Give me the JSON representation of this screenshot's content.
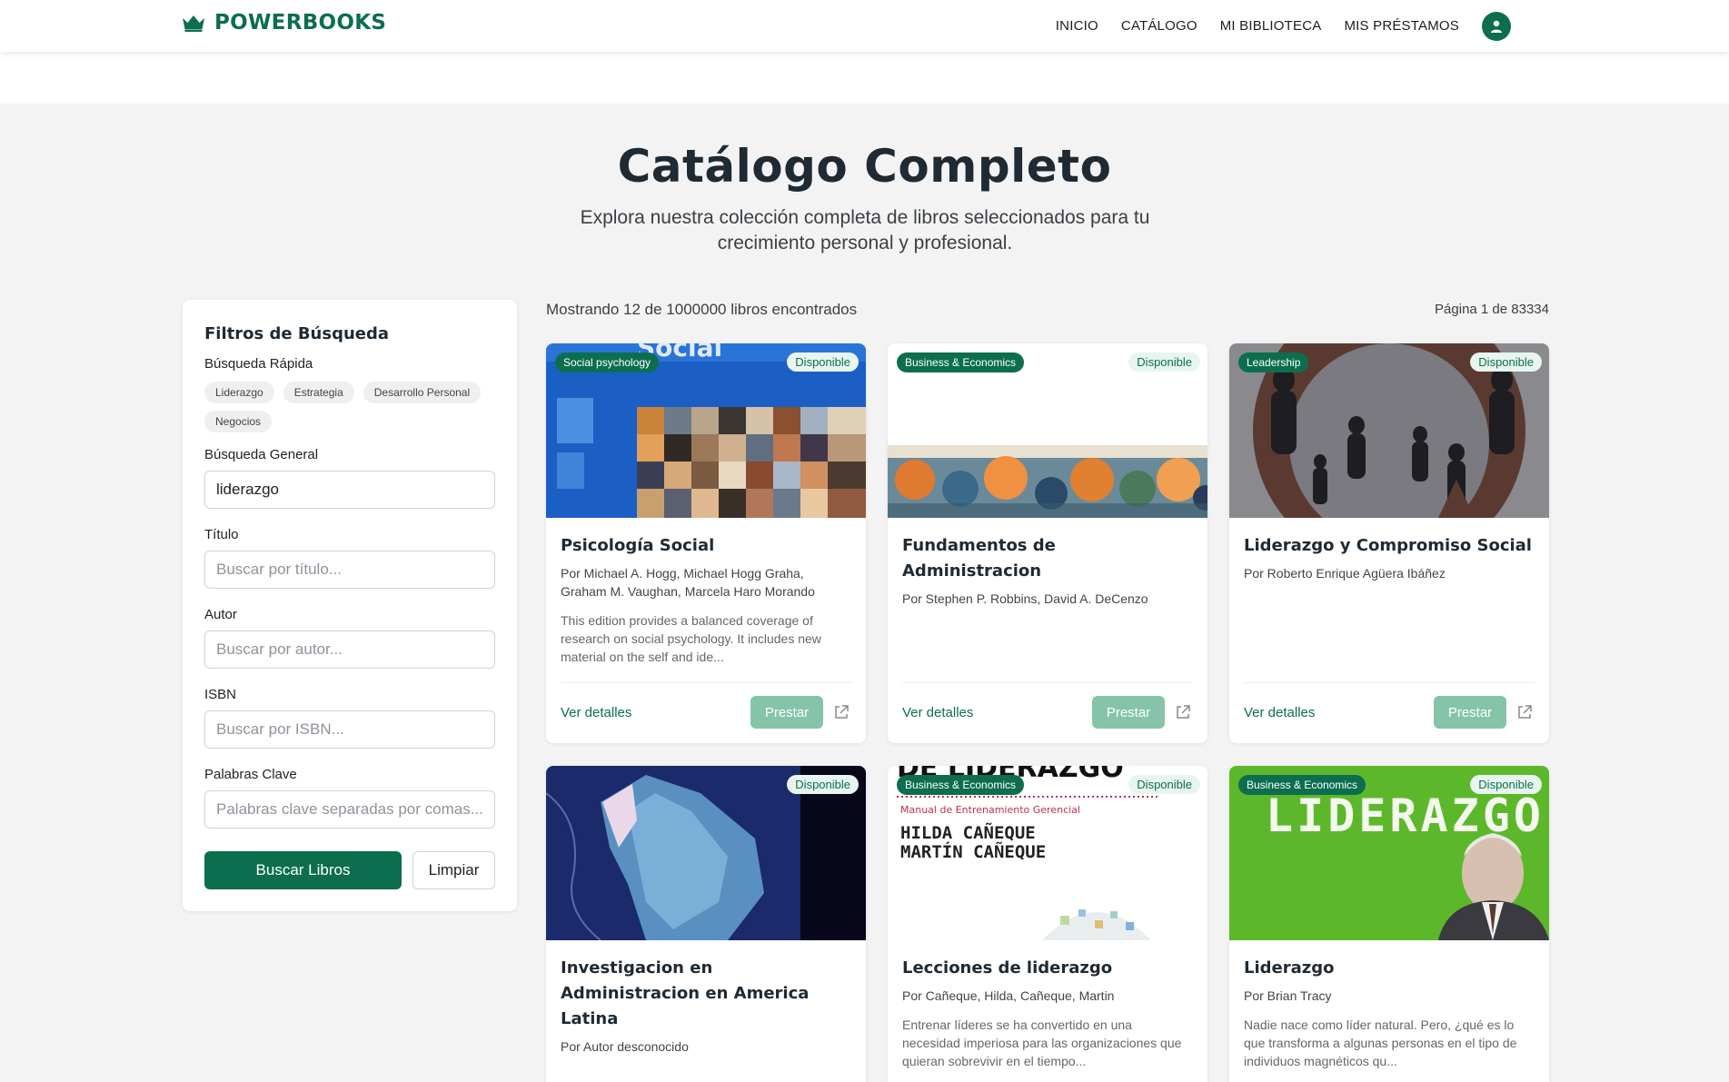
{
  "header": {
    "brand": "POWERBOOKS",
    "nav": [
      "INICIO",
      "CATÁLOGO",
      "MI BIBLIOTECA",
      "MIS PRÉSTAMOS"
    ]
  },
  "hero": {
    "title": "Catálogo Completo",
    "subtitle": "Explora nuestra colección completa de libros seleccionados para tu crecimiento personal y profesional."
  },
  "filters": {
    "title": "Filtros de Búsqueda",
    "quick_label": "Búsqueda Rápida",
    "chips": [
      "Liderazgo",
      "Estrategia",
      "Desarrollo Personal",
      "Negocios"
    ],
    "general_label": "Búsqueda General",
    "general_value": "liderazgo",
    "title_label": "Título",
    "title_placeholder": "Buscar por título...",
    "author_label": "Autor",
    "author_placeholder": "Buscar por autor...",
    "isbn_label": "ISBN",
    "isbn_placeholder": "Buscar por ISBN...",
    "keywords_label": "Palabras Clave",
    "keywords_placeholder": "Palabras clave separadas por comas...",
    "search_button": "Buscar Libros",
    "clear_button": "Limpiar"
  },
  "results": {
    "count": "Mostrando 12 de 1000000 libros encontrados",
    "page": "Página 1 de 83334"
  },
  "card_labels": {
    "details": "Ver detalles",
    "lend": "Prestar"
  },
  "books": [
    {
      "category": "Social psychology",
      "status": "Disponible",
      "title": "Psicología Social",
      "author": "Por Michael A. Hogg, Michael Hogg Graha, Graham M. Vaughan, Marcela Haro Morando",
      "description": "This edition provides a balanced coverage of research on social psychology. It includes new material on the self and ide..."
    },
    {
      "category": "Business & Economics",
      "status": "Disponible",
      "title": "Fundamentos de Administracion",
      "author": "Por Stephen P. Robbins, David A. DeCenzo",
      "description": ""
    },
    {
      "category": "Leadership",
      "status": "Disponible",
      "title": "Liderazgo y Compromiso Social",
      "author": "Por Roberto Enrique Agüera Ibáñez",
      "description": ""
    },
    {
      "category": "",
      "status": "Disponible",
      "title": "Investigacion en Administracion en America Latina",
      "author": "Por Autor desconocido",
      "description": ""
    },
    {
      "category": "Business & Economics",
      "status": "Disponible",
      "title": "Lecciones de liderazgo",
      "author": "Por Cañeque, Hilda, Cañeque, Martin",
      "description": "Entrenar líderes se ha convertido en una necesidad imperiosa para las organizaciones que quieran sobrevivir en el tiempo...",
      "cover_text": [
        "DE LIDERAZGO",
        "Manual de Entrenamiento Gerencial",
        "HILDA CAÑEQUE",
        "MARTÍN CAÑEQUE"
      ]
    },
    {
      "category": "Business & Economics",
      "status": "Disponible",
      "title": "Liderazgo",
      "author": "Por Brian Tracy",
      "description": "Nadie nace como líder natural. Pero, ¿qué es lo que transforma a algunas personas en el tipo de individuos magnéticos qu...",
      "cover_text": [
        "LIDERAZGO"
      ]
    }
  ]
}
